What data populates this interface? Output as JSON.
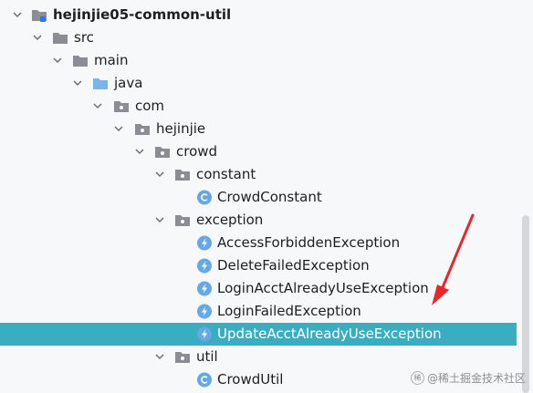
{
  "tree": {
    "root": "hejinjie05-common-util",
    "src": "src",
    "main": "main",
    "java": "java",
    "com": "com",
    "hejinjie": "hejinjie",
    "crowd": "crowd",
    "constant": "constant",
    "crowd_constant": "CrowdConstant",
    "exception": "exception",
    "access_forbidden": "AccessForbiddenException",
    "delete_failed": "DeleteFailedException",
    "login_acct_already_use": "LoginAcctAlreadyUseException",
    "login_failed": "LoginFailedException",
    "update_acct_already_use": "UpdateAcctAlreadyUseException",
    "util": "util",
    "crowd_util": "CrowdUtil"
  },
  "selected_item": "UpdateAcctAlreadyUseException",
  "watermark": {
    "badge": "稀",
    "text": "@稀土掘金技术社区"
  },
  "colors": {
    "selection": "#3aadc1",
    "folder": "#8a8d93",
    "java_folder": "#7bb4e8",
    "class_icon": "#64a8e6",
    "exception_icon": "#64a8e6",
    "arrow": "#e8262b"
  },
  "icons": {
    "module": "module-icon",
    "folder": "folder-icon",
    "source_root": "source-root-icon",
    "package": "package-icon",
    "class": "class-icon",
    "exception": "exception-class-icon",
    "expand": "chevron-down-icon"
  }
}
